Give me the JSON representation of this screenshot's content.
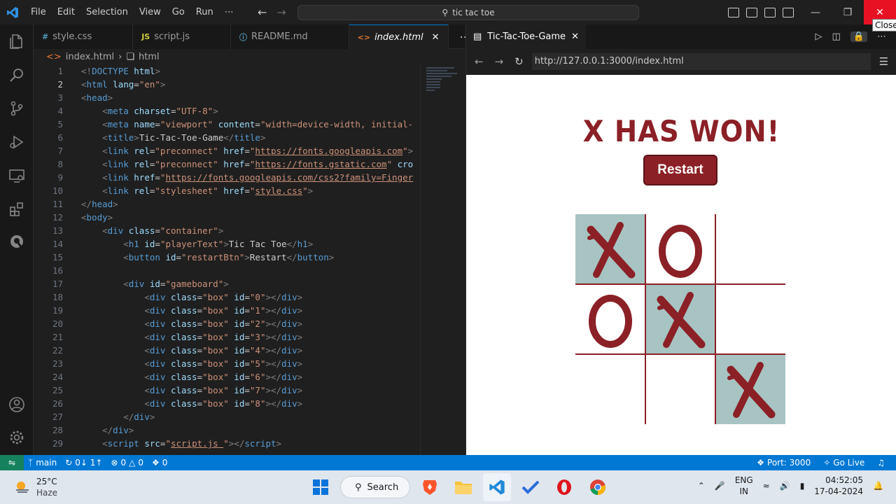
{
  "titlebar": {
    "menu": [
      "File",
      "Edit",
      "Selection",
      "View",
      "Go",
      "Run",
      "⋯"
    ],
    "search_text": "tic tac toe",
    "close_tooltip": "Close"
  },
  "editor": {
    "tabs": [
      {
        "label": "style.css",
        "icon": "#"
      },
      {
        "label": "script.js",
        "icon": "JS"
      },
      {
        "label": "README.md",
        "icon": "ⓘ"
      },
      {
        "label": "index.html",
        "icon": "<>"
      }
    ],
    "breadcrumb": [
      "index.html",
      "html"
    ],
    "lines": [
      {
        "n": "1",
        "html": "<span class='p'>&lt;!</span><span class='t'>DOCTYPE</span> <span class='a'>html</span><span class='p'>&gt;</span>"
      },
      {
        "n": "2",
        "html": "<span class='p'>&lt;</span><span class='t'>html</span> <span class='a'>lang</span>=<span class='s'>\"en\"</span><span class='p'>&gt;</span>"
      },
      {
        "n": "3",
        "html": "<span class='p'>&lt;</span><span class='t'>head</span><span class='p'>&gt;</span>"
      },
      {
        "n": "4",
        "html": "    <span class='p'>&lt;</span><span class='t'>meta</span> <span class='a'>charset</span>=<span class='s'>\"UTF-8\"</span><span class='p'>&gt;</span>"
      },
      {
        "n": "5",
        "html": "    <span class='p'>&lt;</span><span class='t'>meta</span> <span class='a'>name</span>=<span class='s'>\"viewport\"</span> <span class='a'>content</span>=<span class='s'>\"width=device-width, initial-</span>"
      },
      {
        "n": "6",
        "html": "    <span class='p'>&lt;</span><span class='t'>title</span><span class='p'>&gt;</span>Tic-Tac-Toe-Game<span class='p'>&lt;/</span><span class='t'>title</span><span class='p'>&gt;</span>"
      },
      {
        "n": "7",
        "html": "    <span class='p'>&lt;</span><span class='t'>link</span> <span class='a'>rel</span>=<span class='s'>\"preconnect\"</span> <span class='a'>href</span>=<span class='s'>\"<span class='u'>https://fonts.googleapis.com</span>\"</span><span class='p'>&gt;</span>"
      },
      {
        "n": "8",
        "html": "    <span class='p'>&lt;</span><span class='t'>link</span> <span class='a'>rel</span>=<span class='s'>\"preconnect\"</span> <span class='a'>href</span>=<span class='s'>\"<span class='u'>https://fonts.gstatic.com</span>\"</span> <span class='a'>cro</span>"
      },
      {
        "n": "9",
        "html": "    <span class='p'>&lt;</span><span class='t'>link</span> <span class='a'>href</span>=<span class='s'>\"<span class='u'>https://fonts.googleapis.com/css2?family=Finger</span></span>"
      },
      {
        "n": "10",
        "html": "    <span class='p'>&lt;</span><span class='t'>link</span> <span class='a'>rel</span>=<span class='s'>\"stylesheet\"</span> <span class='a'>href</span>=<span class='s'>\"<span class='u'>style.css</span>\"</span><span class='p'>&gt;</span>"
      },
      {
        "n": "11",
        "html": "<span class='p'>&lt;/</span><span class='t'>head</span><span class='p'>&gt;</span>"
      },
      {
        "n": "12",
        "html": "<span class='p'>&lt;</span><span class='t'>body</span><span class='p'>&gt;</span>"
      },
      {
        "n": "13",
        "html": "    <span class='p'>&lt;</span><span class='t'>div</span> <span class='a'>class</span>=<span class='s'>\"container\"</span><span class='p'>&gt;</span>"
      },
      {
        "n": "14",
        "html": "        <span class='p'>&lt;</span><span class='t'>h1</span> <span class='a'>id</span>=<span class='s'>\"playerText\"</span><span class='p'>&gt;</span>Tic Tac Toe<span class='p'>&lt;/</span><span class='t'>h1</span><span class='p'>&gt;</span>"
      },
      {
        "n": "15",
        "html": "        <span class='p'>&lt;</span><span class='t'>button</span> <span class='a'>id</span>=<span class='s'>\"restartBtn\"</span><span class='p'>&gt;</span>Restart<span class='p'>&lt;/</span><span class='t'>button</span><span class='p'>&gt;</span>"
      },
      {
        "n": "16",
        "html": ""
      },
      {
        "n": "17",
        "html": "        <span class='p'>&lt;</span><span class='t'>div</span> <span class='a'>id</span>=<span class='s'>\"gameboard\"</span><span class='p'>&gt;</span>"
      },
      {
        "n": "18",
        "html": "            <span class='p'>&lt;</span><span class='t'>div</span> <span class='a'>class</span>=<span class='s'>\"box\"</span> <span class='a'>id</span>=<span class='s'>\"0\"</span><span class='p'>&gt;&lt;/</span><span class='t'>div</span><span class='p'>&gt;</span>"
      },
      {
        "n": "19",
        "html": "            <span class='p'>&lt;</span><span class='t'>div</span> <span class='a'>class</span>=<span class='s'>\"box\"</span> <span class='a'>id</span>=<span class='s'>\"1\"</span><span class='p'>&gt;&lt;/</span><span class='t'>div</span><span class='p'>&gt;</span>"
      },
      {
        "n": "20",
        "html": "            <span class='p'>&lt;</span><span class='t'>div</span> <span class='a'>class</span>=<span class='s'>\"box\"</span> <span class='a'>id</span>=<span class='s'>\"2\"</span><span class='p'>&gt;&lt;/</span><span class='t'>div</span><span class='p'>&gt;</span>"
      },
      {
        "n": "21",
        "html": "            <span class='p'>&lt;</span><span class='t'>div</span> <span class='a'>class</span>=<span class='s'>\"box\"</span> <span class='a'>id</span>=<span class='s'>\"3\"</span><span class='p'>&gt;&lt;/</span><span class='t'>div</span><span class='p'>&gt;</span>"
      },
      {
        "n": "22",
        "html": "            <span class='p'>&lt;</span><span class='t'>div</span> <span class='a'>class</span>=<span class='s'>\"box\"</span> <span class='a'>id</span>=<span class='s'>\"4\"</span><span class='p'>&gt;&lt;/</span><span class='t'>div</span><span class='p'>&gt;</span>"
      },
      {
        "n": "23",
        "html": "            <span class='p'>&lt;</span><span class='t'>div</span> <span class='a'>class</span>=<span class='s'>\"box\"</span> <span class='a'>id</span>=<span class='s'>\"5\"</span><span class='p'>&gt;&lt;/</span><span class='t'>div</span><span class='p'>&gt;</span>"
      },
      {
        "n": "24",
        "html": "            <span class='p'>&lt;</span><span class='t'>div</span> <span class='a'>class</span>=<span class='s'>\"box\"</span> <span class='a'>id</span>=<span class='s'>\"6\"</span><span class='p'>&gt;&lt;/</span><span class='t'>div</span><span class='p'>&gt;</span>"
      },
      {
        "n": "25",
        "html": "            <span class='p'>&lt;</span><span class='t'>div</span> <span class='a'>class</span>=<span class='s'>\"box\"</span> <span class='a'>id</span>=<span class='s'>\"7\"</span><span class='p'>&gt;&lt;/</span><span class='t'>div</span><span class='p'>&gt;</span>"
      },
      {
        "n": "26",
        "html": "            <span class='p'>&lt;</span><span class='t'>div</span> <span class='a'>class</span>=<span class='s'>\"box\"</span> <span class='a'>id</span>=<span class='s'>\"8\"</span><span class='p'>&gt;&lt;/</span><span class='t'>div</span><span class='p'>&gt;</span>"
      },
      {
        "n": "27",
        "html": "        <span class='p'>&lt;/</span><span class='t'>div</span><span class='p'>&gt;</span>"
      },
      {
        "n": "28",
        "html": "    <span class='p'>&lt;/</span><span class='t'>div</span><span class='p'>&gt;</span>"
      },
      {
        "n": "29",
        "html": "    <span class='p'>&lt;</span><span class='t'>script</span> <span class='a'>src</span>=<span class='s'>\"<span class='u'>script.js </span>\"</span><span class='p'>&gt;&lt;/</span><span class='t'>script</span><span class='p'>&gt;</span>"
      }
    ]
  },
  "browser": {
    "tab_title": "Tic-Tac-Toe-Game",
    "url": "http://127.0.0.1:3000/index.html",
    "page": {
      "heading": "X HAS WON!",
      "restart_label": "Restart",
      "board": [
        "X",
        "O",
        "",
        "O",
        "X",
        "",
        "",
        "",
        "X"
      ],
      "winning_boxes": [
        0,
        4,
        8
      ]
    },
    "colors": {
      "accent": "#8b2026",
      "win_cell": "#a7c4c2"
    }
  },
  "statusbar": {
    "branch": "main",
    "sync": "0↓ 1↑",
    "errors": "0",
    "warnings": "0",
    "ports": "0",
    "port": "Port: 3000",
    "golive": "Go Live"
  },
  "taskbar": {
    "temp": "25°C",
    "weather": "Haze",
    "search": "Search",
    "lang1": "ENG",
    "lang2": "IN",
    "time": "04:52:05",
    "date": "17-04-2024"
  }
}
